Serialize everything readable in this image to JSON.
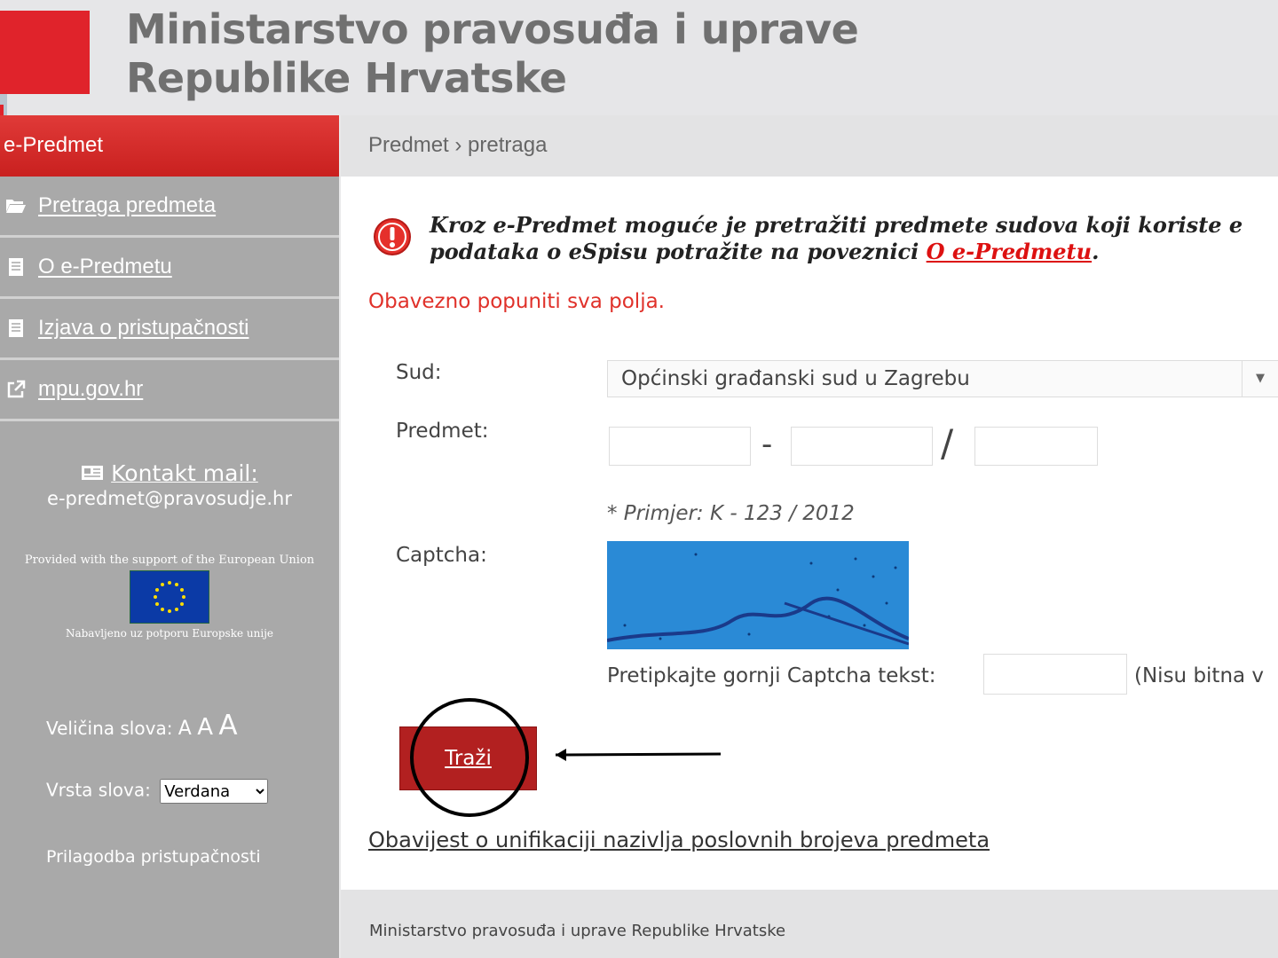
{
  "header": {
    "title_line1": "Ministarstvo pravosuđa i uprave",
    "title_line2": "Republike Hrvatske"
  },
  "sidebar": {
    "title": "e-Predmet",
    "items": [
      {
        "label": "Pretraga predmeta",
        "icon": "folder-open-icon"
      },
      {
        "label": "O e-Predmetu",
        "icon": "document-icon"
      },
      {
        "label": "Izjava o pristupačnosti",
        "icon": "document-icon"
      },
      {
        "label": "mpu.gov.hr",
        "icon": "external-link-icon"
      }
    ],
    "contact_title": "Kontakt mail:",
    "contact_email": "e-predmet@pravosudje.hr",
    "eu_top": "Provided with the support of the European Union",
    "eu_bottom": "Nabavljeno uz potporu Europske unije",
    "font_size_label": "Veličina slova:",
    "font_size_a": "A",
    "font_type_label": "Vrsta slova:",
    "font_type_value": "Verdana",
    "accessibility": "Prilagodba pristupačnosti"
  },
  "breadcrumb": "Predmet › pretraga",
  "main": {
    "info_line1": "Kroz e-Predmet moguće je pretražiti predmete sudova koji koriste e",
    "info_line2": "podataka o eSpisu potražite na poveznici ",
    "info_link": "O e-Predmetu",
    "info_end": ".",
    "required": "Obavezno popuniti sva polja.",
    "court_label": "Sud:",
    "court_value": "Općinski građanski sud u Zagrebu",
    "case_label": "Predmet:",
    "case_dash": "-",
    "case_slash": "/",
    "example": "* Primjer: K - 123 / 2012",
    "captcha_label": "Captcha:",
    "captcha_prompt": "Pretipkajte gornji Captcha tekst:",
    "captcha_hint": "(Nisu bitna v",
    "search_button": "Traži",
    "notice_link": "Obavijest o unifikaciji nazivlja poslovnih brojeva predmeta"
  },
  "footer": "Ministarstvo pravosuđa i uprave Republike Hrvatske",
  "colors": {
    "brand_red": "#e0232b",
    "sidebar_gray": "#a9a9a9",
    "button_red": "#b22020"
  }
}
